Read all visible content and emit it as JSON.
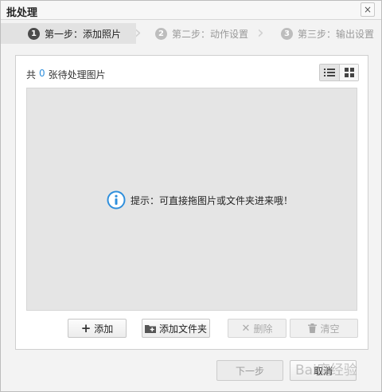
{
  "window": {
    "title": "批处理",
    "close_symbol": "×"
  },
  "steps": [
    {
      "number": "1",
      "label": "第一步：添加照片",
      "active": true
    },
    {
      "number": "2",
      "label": "第二步：动作设置",
      "active": false
    },
    {
      "number": "3",
      "label": "第三步：输出设置",
      "active": false
    }
  ],
  "count": {
    "prefix": "共",
    "value": "0",
    "suffix": "张待处理图片"
  },
  "hint": {
    "text": "提示：可直接拖图片或文件夹进来哦！"
  },
  "buttons": {
    "add": "添加",
    "add_folder": "添加文件夹",
    "delete": "删除",
    "clear": "清空"
  },
  "footer": {
    "next": "下一步",
    "cancel": "取消"
  },
  "watermark": {
    "text": "Bai度经验"
  },
  "colors": {
    "accent": "#2f8fdc",
    "info_icon": "#2f8fdc"
  }
}
